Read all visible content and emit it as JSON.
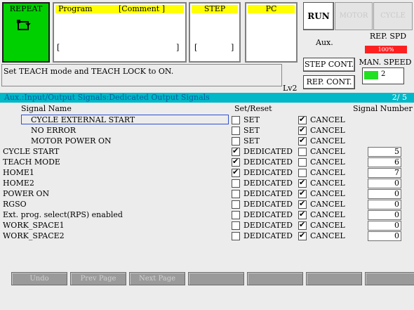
{
  "top": {
    "repeat_label": "REPEAT",
    "program_label": "Program",
    "comment_label": "[Comment ]",
    "program_open": "[",
    "program_close": "]",
    "step_label": "STEP",
    "step_open": "[",
    "step_close": "]",
    "pc_label": "PC",
    "run_label": "RUN",
    "motor_label": "MOTOR",
    "cycle_label": "CYCLE",
    "aux_label": "Aux.",
    "rep_spd_label": "REP. SPD",
    "rep_spd_value": "100%",
    "man_speed_label": "MAN. SPEED",
    "man_speed_value": "2",
    "step_cont_label": "STEP CONT.",
    "rep_cont_label": "REP. CONT.",
    "level_label": "Lv2"
  },
  "message": "Set TEACH mode and TEACH LOCK to ON.",
  "title_bar": {
    "title": "Aux.:Input/Output Signals:Dedicated Output Signals",
    "page": "2/ 5"
  },
  "columns": {
    "signal_name": "Signal Name",
    "set_reset": "Set/Reset",
    "signal_number": "Signal Number"
  },
  "rows": [
    {
      "name": "CYCLE EXTERNAL START",
      "indent": true,
      "selected": true,
      "opt1": "SET",
      "opt1_checked": false,
      "opt2": "CANCEL",
      "opt2_checked": true,
      "number": ""
    },
    {
      "name": "NO ERROR",
      "indent": true,
      "selected": false,
      "opt1": "SET",
      "opt1_checked": false,
      "opt2": "CANCEL",
      "opt2_checked": true,
      "number": ""
    },
    {
      "name": "MOTOR POWER ON",
      "indent": true,
      "selected": false,
      "opt1": "SET",
      "opt1_checked": false,
      "opt2": "CANCEL",
      "opt2_checked": true,
      "number": ""
    },
    {
      "name": "CYCLE START",
      "indent": false,
      "selected": false,
      "opt1": "DEDICATED",
      "opt1_checked": true,
      "opt2": "CANCEL",
      "opt2_checked": false,
      "number": "5"
    },
    {
      "name": "TEACH MODE",
      "indent": false,
      "selected": false,
      "opt1": "DEDICATED",
      "opt1_checked": true,
      "opt2": "CANCEL",
      "opt2_checked": false,
      "number": "6"
    },
    {
      "name": "HOME1",
      "indent": false,
      "selected": false,
      "opt1": "DEDICATED",
      "opt1_checked": true,
      "opt2": "CANCEL",
      "opt2_checked": false,
      "number": "7"
    },
    {
      "name": "HOME2",
      "indent": false,
      "selected": false,
      "opt1": "DEDICATED",
      "opt1_checked": false,
      "opt2": "CANCEL",
      "opt2_checked": true,
      "number": "0"
    },
    {
      "name": "POWER ON",
      "indent": false,
      "selected": false,
      "opt1": "DEDICATED",
      "opt1_checked": false,
      "opt2": "CANCEL",
      "opt2_checked": true,
      "number": "0"
    },
    {
      "name": "RGSO",
      "indent": false,
      "selected": false,
      "opt1": "DEDICATED",
      "opt1_checked": false,
      "opt2": "CANCEL",
      "opt2_checked": true,
      "number": "0"
    },
    {
      "name": "Ext. prog. select(RPS) enabled",
      "indent": false,
      "selected": false,
      "opt1": "DEDICATED",
      "opt1_checked": false,
      "opt2": "CANCEL",
      "opt2_checked": true,
      "number": "0"
    },
    {
      "name": "WORK_SPACE1",
      "indent": false,
      "selected": false,
      "opt1": "DEDICATED",
      "opt1_checked": false,
      "opt2": "CANCEL",
      "opt2_checked": true,
      "number": "0"
    },
    {
      "name": "WORK_SPACE2",
      "indent": false,
      "selected": false,
      "opt1": "DEDICATED",
      "opt1_checked": false,
      "opt2": "CANCEL",
      "opt2_checked": true,
      "number": "0"
    }
  ],
  "function_keys": [
    "Undo",
    "Prev Page",
    "Next Page",
    "",
    "",
    "",
    ""
  ],
  "colors": {
    "repeat_bg": "#00d000",
    "label_yellow": "#ffff00",
    "title_bar": "#00b8c8",
    "rep_spd_red": "#ff2020",
    "man_speed_green": "#20e020",
    "selection_border": "#3050d0"
  },
  "icons": {
    "repeat": "repeat-loop-icon"
  }
}
